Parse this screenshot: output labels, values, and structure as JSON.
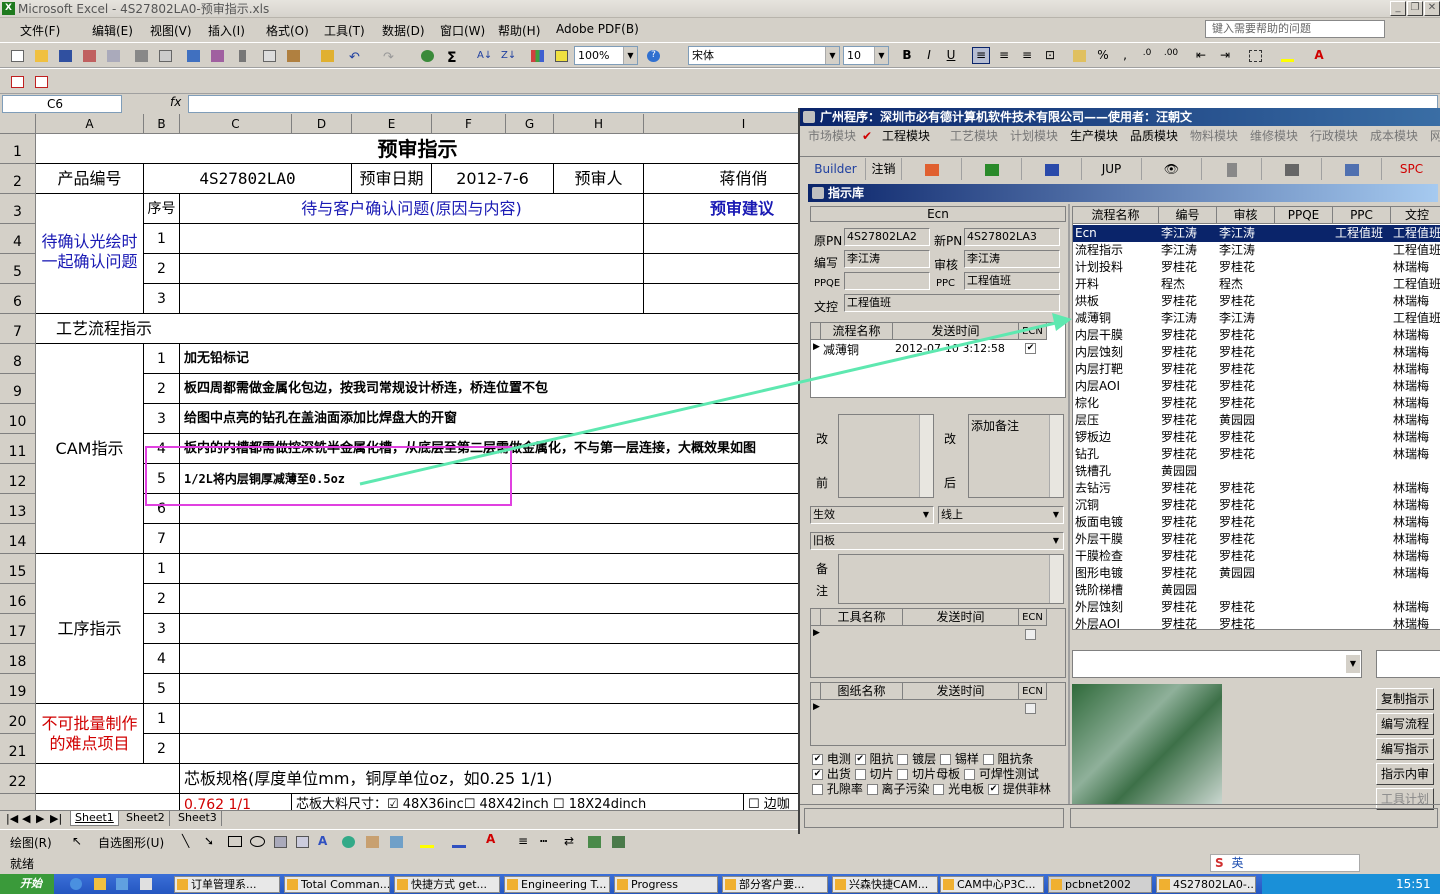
{
  "window": {
    "title": "Microsoft Excel - 4S27802LA0-预审指示.xls"
  },
  "menu": {
    "items": [
      "文件(F)",
      "编辑(E)",
      "视图(V)",
      "插入(I)",
      "格式(O)",
      "工具(T)",
      "数据(D)",
      "窗口(W)",
      "帮助(H)",
      "Adobe PDF(B)"
    ],
    "help_placeholder": "键入需要帮助的问题"
  },
  "toolbar": {
    "zoom": "100%",
    "font": "宋体",
    "size": "10"
  },
  "formula": {
    "name_box": "C6",
    "fx": "fx"
  },
  "columns": [
    "A",
    "B",
    "C",
    "D",
    "E",
    "F",
    "G",
    "H",
    "I"
  ],
  "rows": [
    "1",
    "2",
    "3",
    "4",
    "5",
    "6",
    "7",
    "8",
    "9",
    "10",
    "11",
    "12",
    "13",
    "14",
    "15",
    "16",
    "17",
    "18",
    "19",
    "20",
    "21",
    "22"
  ],
  "sheet": {
    "title": "预审指示",
    "product_label": "产品编号",
    "product_value": "4S27802LA0",
    "date_label": "预审日期",
    "date_value": "2012-7-6",
    "reviewer_label": "预审人",
    "reviewer_value": "蒋俏俏",
    "confirm_label": "待确认光绘时一起确认问题",
    "seq_label": "序号",
    "issue_header": "待与客户确认问题(原因与内容)",
    "advice_header": "预审建议",
    "confirm_nums": [
      "1",
      "2",
      "3"
    ],
    "process_label": "工艺流程指示",
    "cam_label": "CAM指示",
    "cam_items": [
      {
        "n": "1",
        "text": "加无铅标记"
      },
      {
        "n": "2",
        "text": "板四周都需做金属化包边，按我司常规设计桥连，桥连位置不包"
      },
      {
        "n": "3",
        "text": "给图中点亮的钻孔在盖油面添加比焊盘大的开窗"
      },
      {
        "n": "4",
        "text": "板内的内槽都需做控深铣半金属化槽，从底层至第二层需做金属化，不与第一层连接，大概效果如图"
      },
      {
        "n": "5",
        "text": "1/2L将内层铜厚减薄至0.5oz"
      },
      {
        "n": "6",
        "text": ""
      },
      {
        "n": "7",
        "text": ""
      }
    ],
    "proc_label": "工序指示",
    "proc_nums": [
      "1",
      "2",
      "3",
      "4",
      "5"
    ],
    "hard_label": "不可批量制作的难点项目",
    "hard_nums": [
      "1",
      "2"
    ],
    "core_label": "芯板规格(厚度单位mm，铜厚单位oz，如0.25 1/1)",
    "row23_val": "0.762 1/1",
    "row23_text": "芯板大料尺寸：☑ 48X36inc☐ 48X42inch ☐ 18X24dinch",
    "row23_tail": "☐ 边咖"
  },
  "sheet_tabs": [
    "Sheet1",
    "Sheet2",
    "Sheet3"
  ],
  "drawbar": {
    "draw": "绘图(R)",
    "autoshape": "自选图形(U)"
  },
  "status": "就绪",
  "taskbar": {
    "start": "开始",
    "tasks": [
      "订单管理系...",
      "Total Comman...",
      "快捷方式 get...",
      "Engineering T...",
      "Progress",
      "部分客户要...",
      "兴森快捷CAM...",
      "CAM中心P3C...",
      "pcbnet2002",
      "4S27802LA0-..."
    ],
    "clock": "15:51",
    "ime": "英"
  },
  "app": {
    "title": "广州程序：深圳市必有德计算机软件技术有限公司——使用者：汪朝文",
    "modules": [
      "市场模块",
      "工程模块",
      "工艺模块",
      "计划模块",
      "生产模块",
      "品质模块",
      "物料模块",
      "维修模块",
      "行政模块",
      "成本模块",
      "网"
    ],
    "tools": [
      "Builder",
      "注销",
      "JUP",
      "SPC"
    ],
    "sub_title": "指示库",
    "ecn_label": "Ecn",
    "fields": {
      "orig_pn_label": "原PN",
      "orig_pn": "4S27802LA2",
      "new_pn_label": "新PN",
      "new_pn": "4S27802LA3",
      "editor_label": "编写",
      "editor": "李江涛",
      "audit_label": "审核",
      "audit": "李江涛",
      "ppqe_label": "PPQE",
      "ppqe": "",
      "ppc_label": "PPC",
      "ppc": "工程值班",
      "wk_label": "文控",
      "wk": "工程值班"
    },
    "ecn_grid": {
      "headers": [
        "流程名称",
        "发送时间",
        "ECN"
      ],
      "row": {
        "name": "减薄铜",
        "time": "2012-07-10 3:12:58",
        "ecn": "✔"
      }
    },
    "change_before": [
      "改",
      "前"
    ],
    "change_after": [
      "改",
      "后"
    ],
    "add_note": "添加备注",
    "effect_label": "生效",
    "online_label": "线上",
    "oldboard_label": "旧板",
    "note_label": [
      "备",
      "注"
    ],
    "tool_grid": {
      "headers": [
        "工具名称",
        "发送时间",
        "ECN"
      ]
    },
    "drawing_grid": {
      "headers": [
        "图纸名称",
        "发送时间",
        "ECN"
      ]
    },
    "checks": [
      [
        {
          "label": "电测",
          "on": true
        },
        {
          "label": "阻抗",
          "on": true
        },
        {
          "label": "镀层",
          "on": false
        },
        {
          "label": "锡样",
          "on": false
        },
        {
          "label": "阻抗条",
          "on": false
        }
      ],
      [
        {
          "label": "出货",
          "on": true
        },
        {
          "label": "切片",
          "on": false
        },
        {
          "label": "切片母板",
          "on": false
        },
        {
          "label": "可焊性测试",
          "on": false
        }
      ],
      [
        {
          "label": "孔隙率",
          "on": false
        },
        {
          "label": "离子污染",
          "on": false
        },
        {
          "label": "光电板",
          "on": false
        },
        {
          "label": "提供菲林",
          "on": true
        }
      ]
    ],
    "flow_headers": [
      "流程名称",
      "编号",
      "审核",
      "PPQE",
      "PPC",
      "文控"
    ],
    "flow_rows": [
      [
        "Ecn",
        "李江涛",
        "李江涛",
        "",
        "工程值班",
        "工程值班"
      ],
      [
        "流程指示",
        "李江涛",
        "李江涛",
        "",
        "",
        "工程值班"
      ],
      [
        "计划投料",
        "罗桂花",
        "罗桂花",
        "",
        "",
        "林瑞梅"
      ],
      [
        "开料",
        "程杰",
        "程杰",
        "",
        "",
        "工程值班"
      ],
      [
        "烘板",
        "罗桂花",
        "罗桂花",
        "",
        "",
        "林瑞梅"
      ],
      [
        "减薄铜",
        "李江涛",
        "李江涛",
        "",
        "",
        "工程值班"
      ],
      [
        "内层干膜",
        "罗桂花",
        "罗桂花",
        "",
        "",
        "林瑞梅"
      ],
      [
        "内层蚀刻",
        "罗桂花",
        "罗桂花",
        "",
        "",
        "林瑞梅"
      ],
      [
        "内层打靶",
        "罗桂花",
        "罗桂花",
        "",
        "",
        "林瑞梅"
      ],
      [
        "内层AOI",
        "罗桂花",
        "罗桂花",
        "",
        "",
        "林瑞梅"
      ],
      [
        "棕化",
        "罗桂花",
        "罗桂花",
        "",
        "",
        "林瑞梅"
      ],
      [
        "层压",
        "罗桂花",
        "黄园园",
        "",
        "",
        "林瑞梅"
      ],
      [
        "锣板边",
        "罗桂花",
        "罗桂花",
        "",
        "",
        "林瑞梅"
      ],
      [
        "钻孔",
        "罗桂花",
        "罗桂花",
        "",
        "",
        "林瑞梅"
      ],
      [
        "铣槽孔",
        "黄园园",
        "",
        "",
        "",
        ""
      ],
      [
        "去钻污",
        "罗桂花",
        "罗桂花",
        "",
        "",
        "林瑞梅"
      ],
      [
        "沉铜",
        "罗桂花",
        "罗桂花",
        "",
        "",
        "林瑞梅"
      ],
      [
        "板面电镀",
        "罗桂花",
        "罗桂花",
        "",
        "",
        "林瑞梅"
      ],
      [
        "外层干膜",
        "罗桂花",
        "罗桂花",
        "",
        "",
        "林瑞梅"
      ],
      [
        "干膜检查",
        "罗桂花",
        "罗桂花",
        "",
        "",
        "林瑞梅"
      ],
      [
        "图形电镀",
        "罗桂花",
        "黄园园",
        "",
        "",
        "林瑞梅"
      ],
      [
        "铣阶梯槽",
        "黄园园",
        "",
        "",
        "",
        ""
      ],
      [
        "外层蚀刻",
        "罗桂花",
        "罗桂花",
        "",
        "",
        "林瑞梅"
      ],
      [
        "外层AOI",
        "罗桂花",
        "罗桂花",
        "",
        "",
        "林瑞梅"
      ]
    ],
    "side_buttons": [
      "复制指示",
      "编写流程",
      "编写指示",
      "指示内审",
      "工具计划"
    ],
    "highlight_color": "#0a246a",
    "annotation_color": "#e040e0",
    "arrow_color": "#5ee8b0"
  }
}
